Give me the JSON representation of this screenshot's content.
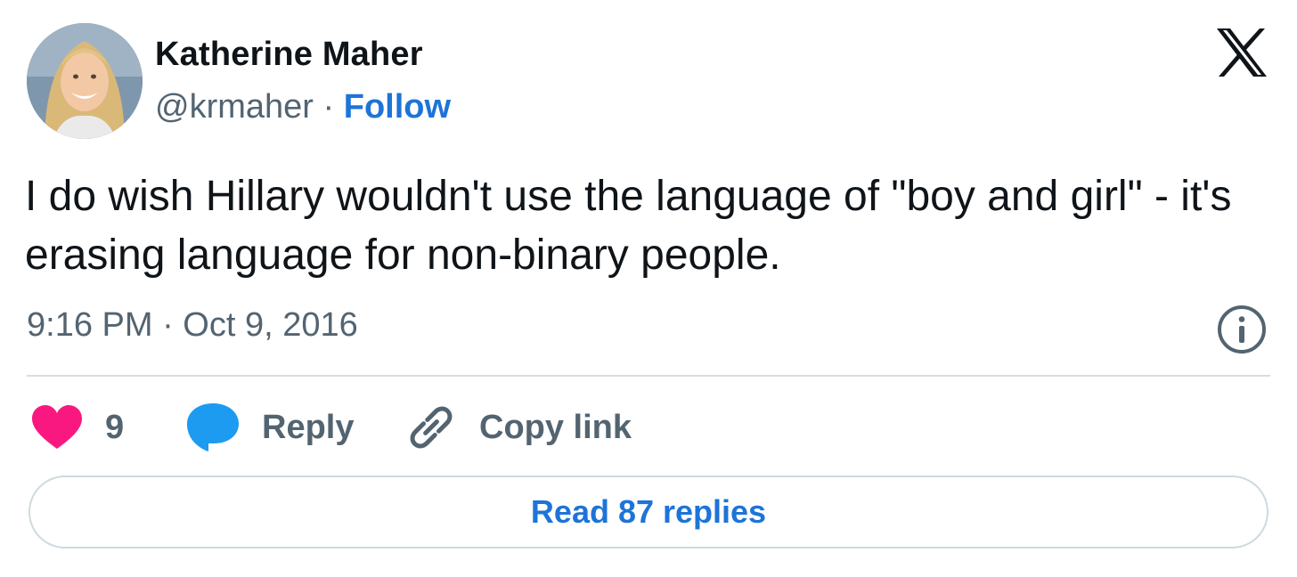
{
  "author": {
    "display_name": "Katherine Maher",
    "handle": "@krmaher",
    "separator": " · ",
    "follow_label": "Follow"
  },
  "tweet": {
    "text": "I do wish Hillary wouldn't use the language of \"boy and girl\" - it's erasing language for non-binary people.",
    "timestamp": "9:16 PM · Oct 9, 2016"
  },
  "actions": {
    "like_count": "9",
    "reply_label": "Reply",
    "copy_link_label": "Copy link"
  },
  "read_replies_label": "Read 87 replies",
  "icons": {
    "brand": "x-logo-icon",
    "info": "info-icon",
    "like": "heart-icon",
    "reply": "speech-bubble-icon",
    "copy": "link-icon"
  },
  "colors": {
    "link_blue": "#1d74d8",
    "like_pink": "#f91880",
    "reply_blue": "#1d9bf0",
    "secondary_text": "#536471",
    "divider": "#d5dde3"
  }
}
